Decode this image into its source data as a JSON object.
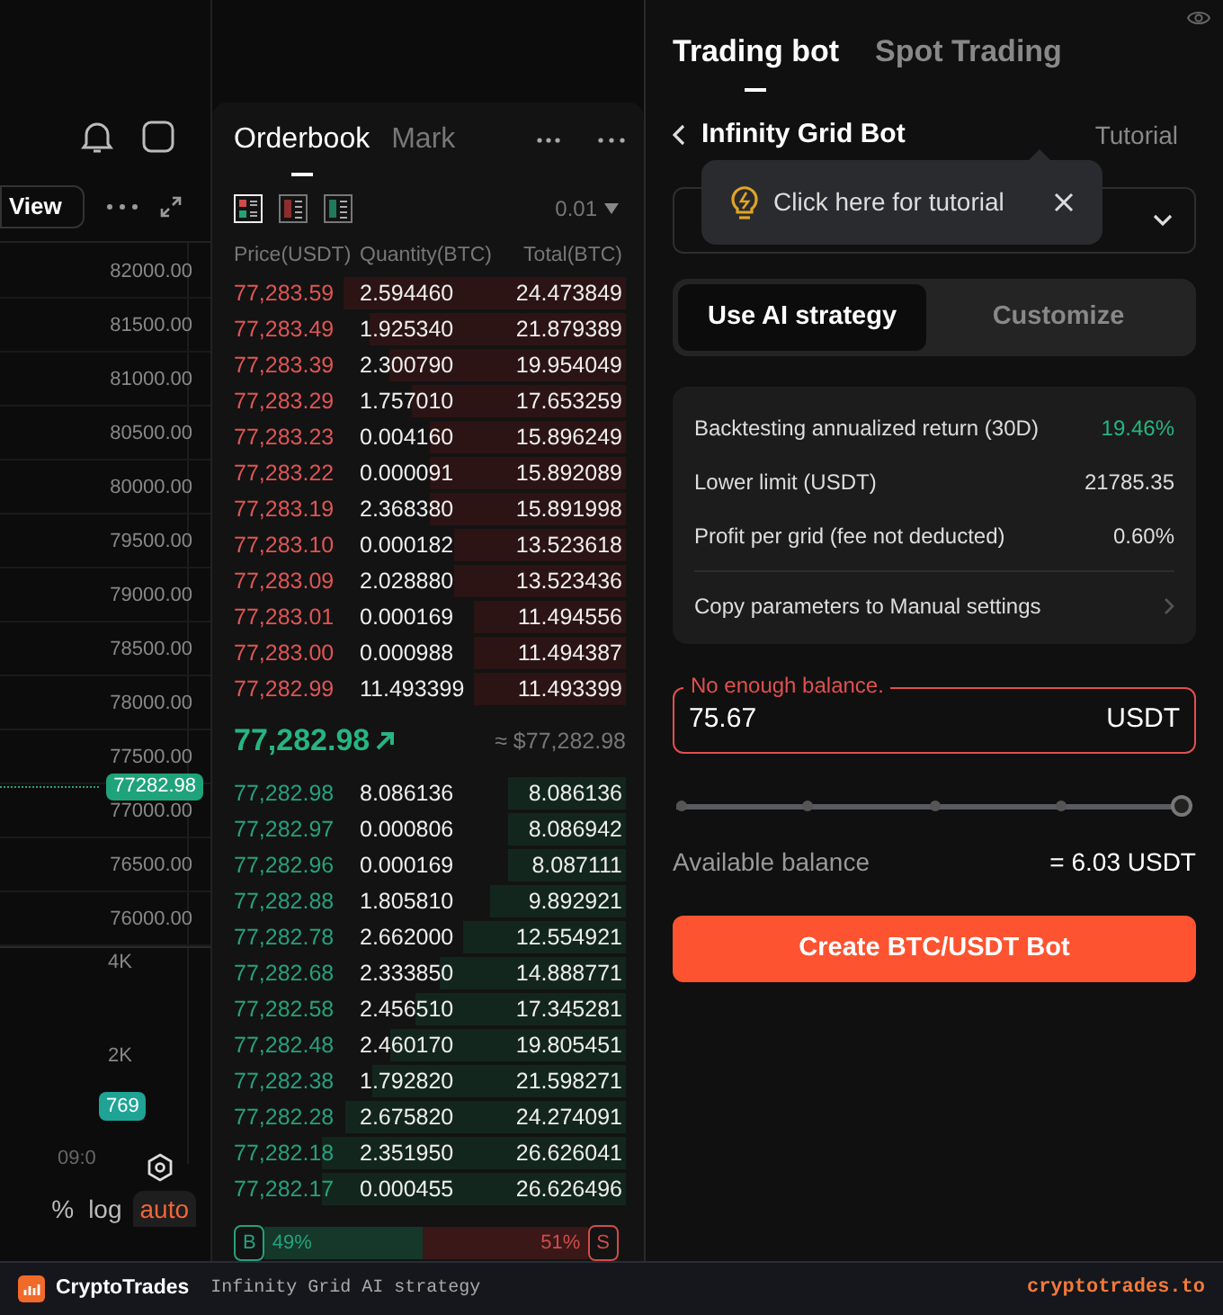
{
  "chart": {
    "view_button": "View",
    "price_axis": [
      "82000.00",
      "81500.00",
      "81000.00",
      "80500.00",
      "80000.00",
      "79500.00",
      "79000.00",
      "78500.00",
      "78000.00",
      "77500.00",
      "77000.00",
      "76500.00",
      "76000.00"
    ],
    "current_price": "77282.98",
    "volume_axis": [
      "4K",
      "2K"
    ],
    "volume_badge": "769",
    "time_label": "09:0",
    "scale_buttons": [
      {
        "label": "%",
        "selected": false
      },
      {
        "label": "log",
        "selected": false
      },
      {
        "label": "auto",
        "selected": true
      }
    ]
  },
  "orderbook": {
    "tabs": [
      {
        "label": "Orderbook",
        "selected": true
      },
      {
        "label": "Mark",
        "selected": false
      }
    ],
    "tick_size": "0.01",
    "columns": [
      "Price(USDT)",
      "Quantity(BTC)",
      "Total(BTC)"
    ],
    "asks": [
      {
        "price": "77,283.59",
        "quantity": "2.594460",
        "total": "24.473849"
      },
      {
        "price": "77,283.49",
        "quantity": "1.925340",
        "total": "21.879389"
      },
      {
        "price": "77,283.39",
        "quantity": "2.300790",
        "total": "19.954049"
      },
      {
        "price": "77,283.29",
        "quantity": "1.757010",
        "total": "17.653259"
      },
      {
        "price": "77,283.23",
        "quantity": "0.004160",
        "total": "15.896249"
      },
      {
        "price": "77,283.22",
        "quantity": "0.000091",
        "total": "15.892089"
      },
      {
        "price": "77,283.19",
        "quantity": "2.368380",
        "total": "15.891998"
      },
      {
        "price": "77,283.10",
        "quantity": "0.000182",
        "total": "13.523618"
      },
      {
        "price": "77,283.09",
        "quantity": "2.028880",
        "total": "13.523436"
      },
      {
        "price": "77,283.01",
        "quantity": "0.000169",
        "total": "11.494556"
      },
      {
        "price": "77,283.00",
        "quantity": "0.000988",
        "total": "11.494387"
      },
      {
        "price": "77,282.99",
        "quantity": "11.493399",
        "total": "11.493399"
      }
    ],
    "last_price": "77,282.98",
    "last_price_usd": "≈ $77,282.98",
    "bids": [
      {
        "price": "77,282.98",
        "quantity": "8.086136",
        "total": "8.086136"
      },
      {
        "price": "77,282.97",
        "quantity": "0.000806",
        "total": "8.086942"
      },
      {
        "price": "77,282.96",
        "quantity": "0.000169",
        "total": "8.087111"
      },
      {
        "price": "77,282.88",
        "quantity": "1.805810",
        "total": "9.892921"
      },
      {
        "price": "77,282.78",
        "quantity": "2.662000",
        "total": "12.554921"
      },
      {
        "price": "77,282.68",
        "quantity": "2.333850",
        "total": "14.888771"
      },
      {
        "price": "77,282.58",
        "quantity": "2.456510",
        "total": "17.345281"
      },
      {
        "price": "77,282.48",
        "quantity": "2.460170",
        "total": "19.805451"
      },
      {
        "price": "77,282.38",
        "quantity": "1.792820",
        "total": "21.598271"
      },
      {
        "price": "77,282.28",
        "quantity": "2.675820",
        "total": "24.274091"
      },
      {
        "price": "77,282.18",
        "quantity": "2.351950",
        "total": "26.626041"
      },
      {
        "price": "77,282.17",
        "quantity": "0.000455",
        "total": "26.626496"
      }
    ],
    "ratio": {
      "buy_label": "B",
      "buy_percent": "49%",
      "sell_percent": "51%",
      "sell_label": "S"
    }
  },
  "bot_panel": {
    "tabs": [
      {
        "label": "Trading bot",
        "selected": true
      },
      {
        "label": "Spot Trading",
        "selected": false
      }
    ],
    "title": "Infinity Grid Bot",
    "tutorial_link": "Tutorial",
    "tooltip": "Click here for tutorial",
    "modes": [
      {
        "label": "Use AI strategy",
        "selected": true
      },
      {
        "label": "Customize",
        "selected": false
      }
    ],
    "stats": [
      {
        "label": "Backtesting annualized return (30D)",
        "value": "19.46%",
        "positive": true
      },
      {
        "label": "Lower limit (USDT)",
        "value": "21785.35",
        "positive": false
      },
      {
        "label": "Profit per grid (fee not deducted)",
        "value": "0.60%",
        "positive": false
      }
    ],
    "copy_link": "Copy parameters to Manual settings",
    "amount": {
      "error": "No enough balance.",
      "value": "75.67",
      "unit": "USDT"
    },
    "slider": {
      "level": 1
    },
    "available_label": "Available balance",
    "available_value": "= 6.03 USDT",
    "create_button": "Create BTC/USDT Bot"
  },
  "footer": {
    "brand": "CryptoTrades",
    "caption": "Infinity Grid AI strategy",
    "site": "cryptotrades.to"
  }
}
